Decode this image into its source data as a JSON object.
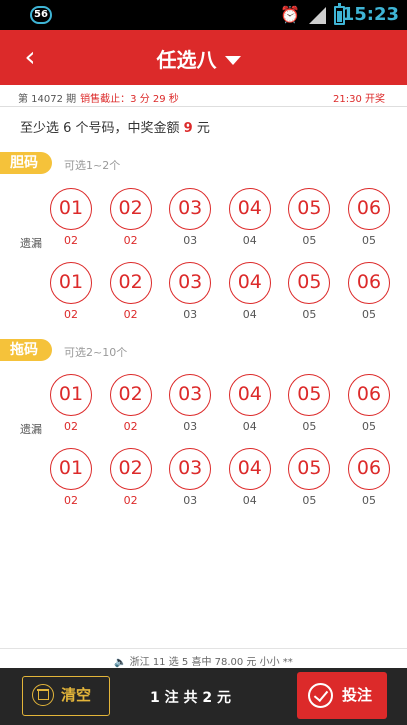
{
  "status_bar": {
    "badge": "56",
    "time": "15:23"
  },
  "header": {
    "title": "任选八"
  },
  "info": {
    "issue": "第 14072 期",
    "deadline": "销售截止：3 分 29 秒",
    "open_time": "21:30 开奖"
  },
  "hint": {
    "prefix": "至少选 6 个号码，中奖金额 ",
    "amount": "9",
    "suffix": " 元"
  },
  "dan": {
    "tag": "胆码",
    "sub": "可选1~2个",
    "row_label": "遗漏",
    "row1": {
      "balls": [
        "01",
        "02",
        "03",
        "04",
        "05",
        "06"
      ],
      "miss": [
        "02",
        "02",
        "03",
        "04",
        "05",
        "05"
      ]
    },
    "row2": {
      "balls": [
        "01",
        "02",
        "03",
        "04",
        "05",
        "06"
      ],
      "miss": [
        "02",
        "02",
        "03",
        "04",
        "05",
        "05"
      ]
    }
  },
  "tuo": {
    "tag": "拖码",
    "sub": "可选2~10个",
    "row_label": "遗漏",
    "row1": {
      "balls": [
        "01",
        "02",
        "03",
        "04",
        "05",
        "06"
      ],
      "miss": [
        "02",
        "02",
        "03",
        "04",
        "05",
        "05"
      ]
    },
    "row2": {
      "balls": [
        "01",
        "02",
        "03",
        "04",
        "05",
        "06"
      ],
      "miss": [
        "02",
        "02",
        "03",
        "04",
        "05",
        "05"
      ]
    }
  },
  "ticker": {
    "text": "浙江 11 选 5 喜中 78.00 元 小小 **"
  },
  "bottom": {
    "clear_label": "清空",
    "summary": "1 注 共 2 元",
    "bet_label": "投注"
  },
  "colors": {
    "accent": "#dc2a2a",
    "tag": "#f5c23a",
    "bar": "#262626"
  }
}
